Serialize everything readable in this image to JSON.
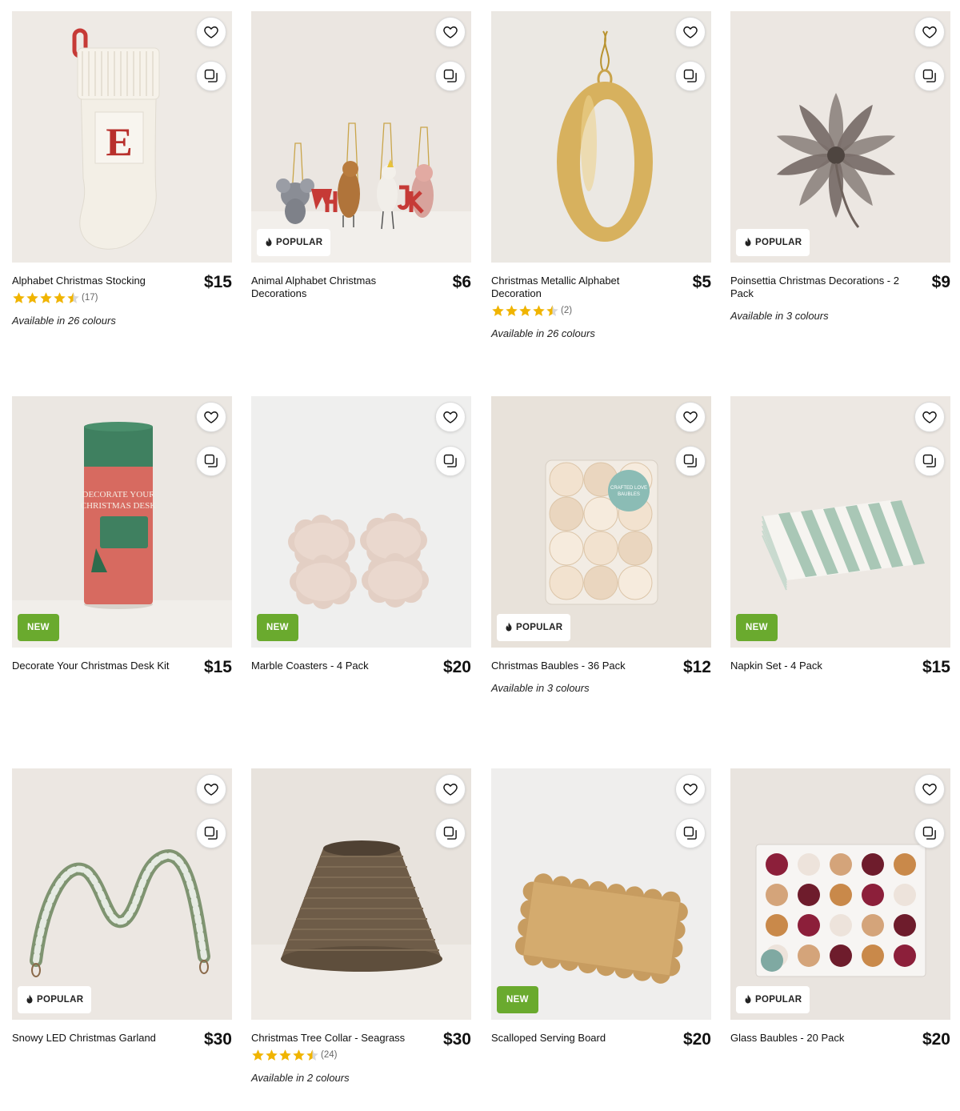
{
  "colors": {
    "badge_new": "#6aaa2e",
    "badge_popular_bg": "#ffffff",
    "star": "#f0b400",
    "star_empty": "#d8d8d8"
  },
  "icons": {
    "wishlist": "heart-icon",
    "compare": "compare-icon",
    "popular": "flame-icon",
    "star": "star-icon"
  },
  "products": [
    {
      "name": "Alphabet Christmas Stocking",
      "price": "$15",
      "badge": "",
      "rating": 4.5,
      "reviews": "(17)",
      "colours": "Available in 26 colours",
      "image": "stocking"
    },
    {
      "name": "Animal Alphabet Christmas Decorations",
      "price": "$6",
      "badge": "POPULAR",
      "rating": null,
      "reviews": "",
      "colours": "",
      "image": "animals"
    },
    {
      "name": "Christmas Metallic Alphabet Decoration",
      "price": "$5",
      "badge": "",
      "rating": 4.5,
      "reviews": "(2)",
      "colours": "Available in 26 colours",
      "image": "letter-o"
    },
    {
      "name": "Poinsettia Christmas Decorations - 2 Pack",
      "price": "$9",
      "badge": "POPULAR",
      "rating": null,
      "reviews": "",
      "colours": "Available in 3 colours",
      "image": "poinsettia"
    },
    {
      "name": "Decorate Your Christmas Desk Kit",
      "price": "$15",
      "badge": "NEW",
      "rating": null,
      "reviews": "",
      "colours": "",
      "image": "desk-kit"
    },
    {
      "name": "Marble Coasters - 4 Pack",
      "price": "$20",
      "badge": "NEW",
      "rating": null,
      "reviews": "",
      "colours": "",
      "image": "coasters"
    },
    {
      "name": "Christmas Baubles - 36 Pack",
      "price": "$12",
      "badge": "POPULAR",
      "rating": null,
      "reviews": "",
      "colours": "Available in 3 colours",
      "image": "baubles-box"
    },
    {
      "name": "Napkin Set - 4 Pack",
      "price": "$15",
      "badge": "NEW",
      "rating": null,
      "reviews": "",
      "colours": "",
      "image": "napkins"
    },
    {
      "name": "Snowy LED Christmas Garland",
      "price": "$30",
      "badge": "POPULAR",
      "rating": null,
      "reviews": "",
      "colours": "",
      "image": "garland"
    },
    {
      "name": "Christmas Tree Collar - Seagrass",
      "price": "$30",
      "badge": "",
      "rating": 4.5,
      "reviews": "(24)",
      "colours": "Available in 2 colours",
      "image": "tree-collar"
    },
    {
      "name": "Scalloped Serving Board",
      "price": "$20",
      "badge": "NEW",
      "rating": null,
      "reviews": "",
      "colours": "",
      "image": "serving-board"
    },
    {
      "name": "Glass Baubles - 20 Pack",
      "price": "$20",
      "badge": "POPULAR",
      "rating": null,
      "reviews": "",
      "colours": "",
      "image": "glass-baubles"
    }
  ]
}
